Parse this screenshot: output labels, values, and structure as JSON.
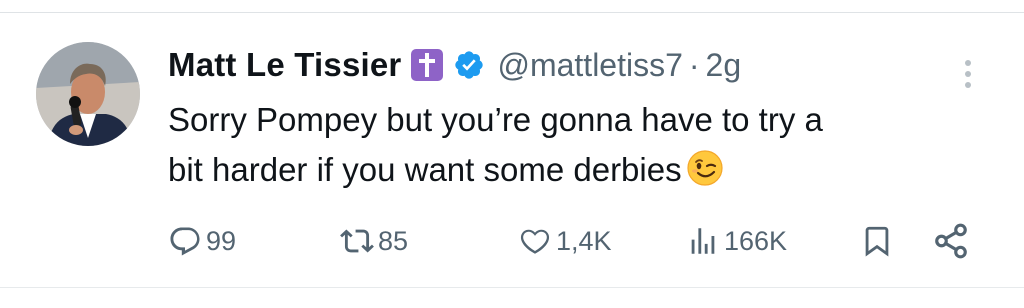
{
  "tweet": {
    "author_name": "Matt Le Tissier",
    "handle": "@mattletiss7",
    "separator": "·",
    "time": "2g",
    "text_lines": [
      "Sorry Pompey but you’re gonna have to try a",
      "bit harder if you want some derbies"
    ],
    "emoji": "winking-face"
  },
  "actions": {
    "replies": "99",
    "reposts": "85",
    "likes": "1,4K",
    "views": "166K"
  },
  "icons": {
    "badge": "latin-cross-icon",
    "verified": "verified-badge-icon",
    "more": "more-vertical-icon",
    "reply": "reply-icon",
    "repost": "repost-icon",
    "like": "heart-icon",
    "views": "views-icon",
    "bookmark": "bookmark-icon",
    "share": "share-icon"
  },
  "colors": {
    "verified": "#1d9bf0",
    "badge": "#8e63c7",
    "secondary_text": "#536471"
  }
}
